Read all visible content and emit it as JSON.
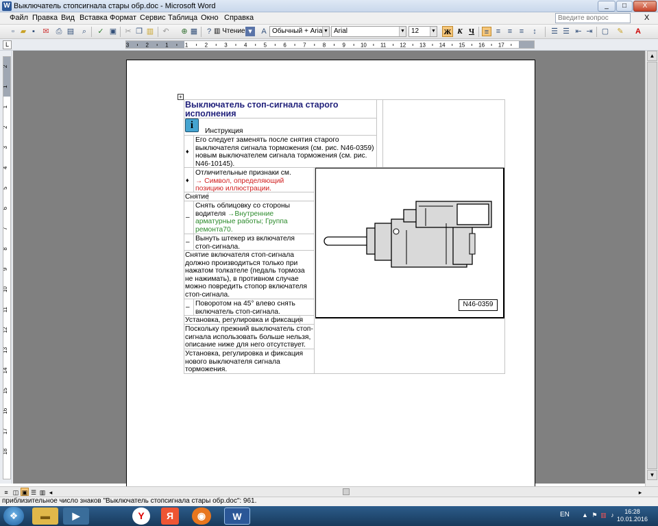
{
  "window": {
    "title": "Выключатель стопсигнала стары обр.doc - Microsoft Word",
    "controls": [
      "_",
      "□",
      "X"
    ]
  },
  "menu": {
    "items": [
      "Файл",
      "Правка",
      "Вид",
      "Вставка",
      "Формат",
      "Сервис",
      "Таблица",
      "Окно",
      "Справка"
    ],
    "ask_placeholder": "Введите вопрос",
    "close_doc": "X"
  },
  "toolbar": {
    "reading_label": "Чтение",
    "style": "Обычный + Arial,",
    "font": "Arial",
    "size": "12",
    "bold": "Ж",
    "italic": "К",
    "underline": "Ч"
  },
  "ruler": {
    "labels": [
      "3",
      "2",
      "1",
      "1",
      "2",
      "3",
      "4",
      "5",
      "6",
      "7",
      "8",
      "9",
      "10",
      "11",
      "12",
      "13",
      "14",
      "15",
      "16",
      "17"
    ],
    "vlabels": [
      "2",
      "1",
      "1",
      "2",
      "3",
      "4",
      "5",
      "6",
      "7",
      "8",
      "9",
      "10",
      "11",
      "12",
      "13",
      "14",
      "15",
      "16",
      "17",
      "18"
    ]
  },
  "document": {
    "title": "Выключатель стоп-сигнала старого исполнения",
    "info_label": "Инструкция",
    "row1": "Его следует заменять после снятия старого выключателя сигнала торможения (см. рис. N46-0359) новым выключателем сигнала торможения (см. рис. N46-10145).",
    "row2_text": "Отличительные признаки см.",
    "row2_link": "→ Символ, определяющий позицию иллюстрации.",
    "removal_heading": "Снятие",
    "step1_text": "Снять облицовку со стороны водителя ",
    "step1_link": "→Внутренние арматурные работы; Группа ремонта70.",
    "step2": "Вынуть штекер из включателя стоп-сигнала.",
    "note": "Снятие включателя стоп-сигнала должно производиться только при нажатом толкателе (педаль тормоза не нажимать), в противном случае можно повредить стопор включателя стоп-сигнала.",
    "step3": "Поворотом на 45° влево снять включатель стоп-сигнала.",
    "install_heading": "Установка, регулировка и фиксация",
    "install_note": "Поскольку прежний выключатель стоп-сигнала использовать больше нельзя, описание ниже для него отсутствует.",
    "install_new": "Установка, регулировка и фиксация нового выключателя сигнала торможения.",
    "figure_label": "N46-0359",
    "bullet": "♦",
    "dash": "–",
    "info_glyph": "i"
  },
  "status": {
    "text": "приблизительное число знаков \"Выключатель стопсигнала стары обр.doc\": 961."
  },
  "taskbar": {
    "lang": "EN",
    "time": "16:28",
    "date": "10.01.2016"
  },
  "colors": {
    "title_blue": "#1f1f7a",
    "link_red": "#d02020",
    "link_green": "#2b8a2b",
    "info_icon": "#45a4d0"
  }
}
